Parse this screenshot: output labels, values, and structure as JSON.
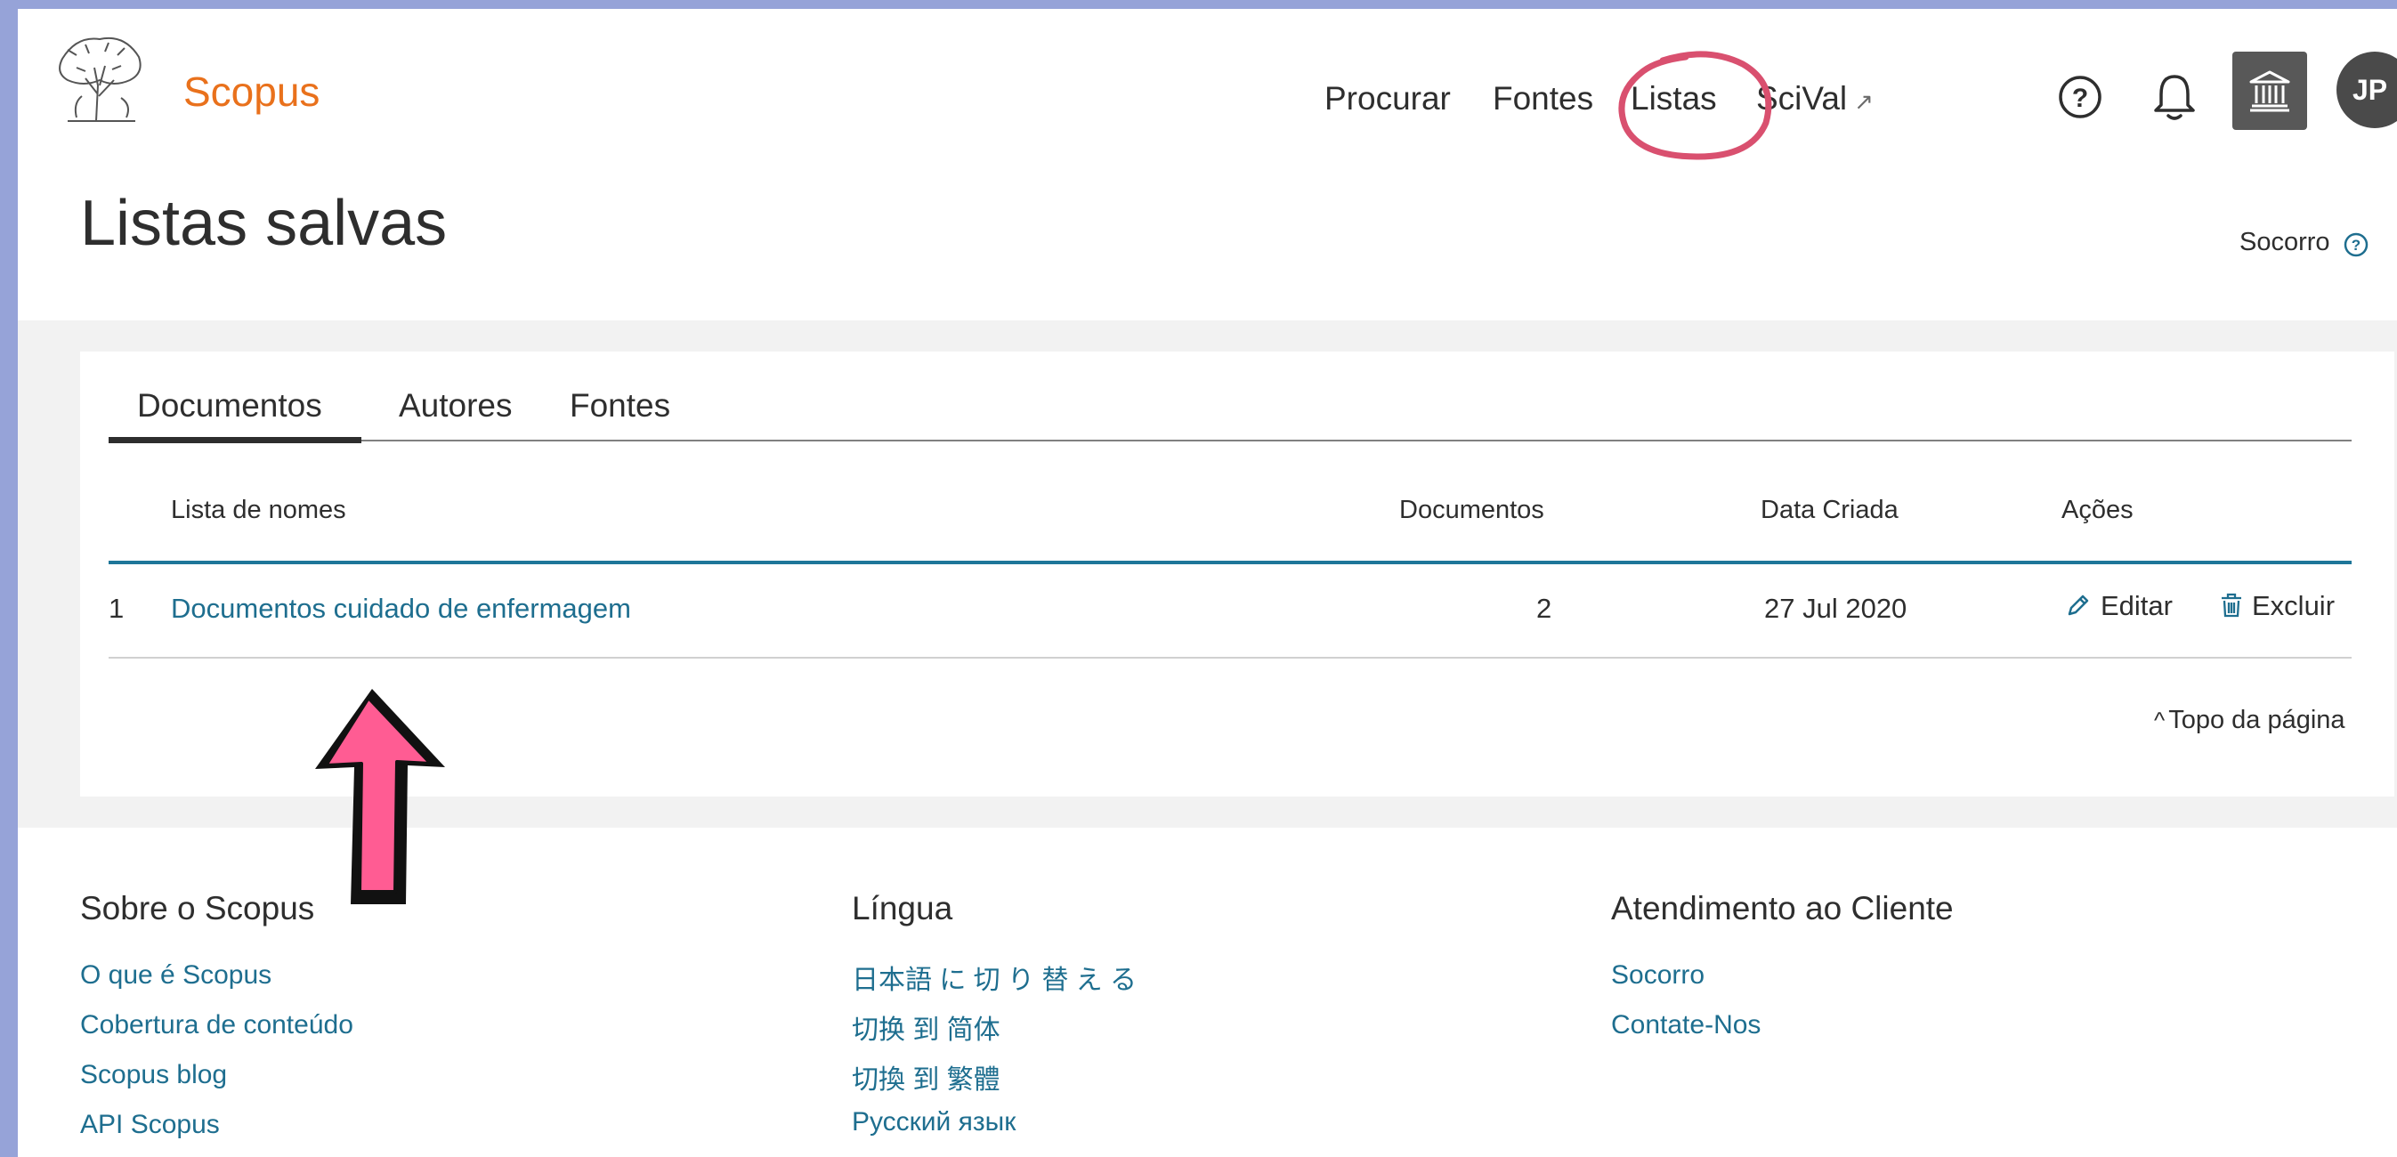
{
  "header": {
    "brand": "Scopus",
    "nav": [
      "Procurar",
      "Fontes",
      "Listas",
      "SciVal"
    ],
    "scival_external_icon": "external-link-icon",
    "avatar_initials": "JP",
    "icons": [
      "help-icon",
      "bell-icon",
      "institution-icon"
    ]
  },
  "page": {
    "title": "Listas salvas",
    "help_link": "Socorro"
  },
  "tabs": [
    "Documentos",
    "Autores",
    "Fontes"
  ],
  "active_tab": "Documentos",
  "table": {
    "columns": [
      "Lista de nomes",
      "Documentos",
      "Data Criada",
      "Ações"
    ],
    "rows": [
      {
        "index": "1",
        "name": "Documentos cuidado de enfermagem",
        "documents": "2",
        "created": "27 Jul 2020",
        "edit_label": "Editar",
        "delete_label": "Excluir"
      }
    ]
  },
  "back_to_top": "Topo da página",
  "footer": {
    "about": {
      "heading": "Sobre o Scopus",
      "links": [
        "O que é Scopus",
        "Cobertura de conteúdo",
        "Scopus blog",
        "API Scopus"
      ]
    },
    "language": {
      "heading": "Língua",
      "links": [
        "日本語 に 切 り 替 え る",
        "切换 到 简体",
        "切換 到 繁體",
        "Русский язык"
      ]
    },
    "support": {
      "heading": "Atendimento ao Cliente",
      "links": [
        "Socorro",
        "Contate-Nos"
      ]
    }
  },
  "colors": {
    "brand_orange": "#e9711c",
    "link_blue": "#1e6e8f",
    "table_rule_blue": "#1e7699",
    "annotation_pink": "#ff5c93",
    "annotation_circle": "#d9506f",
    "page_frame": "#96a3d8"
  }
}
